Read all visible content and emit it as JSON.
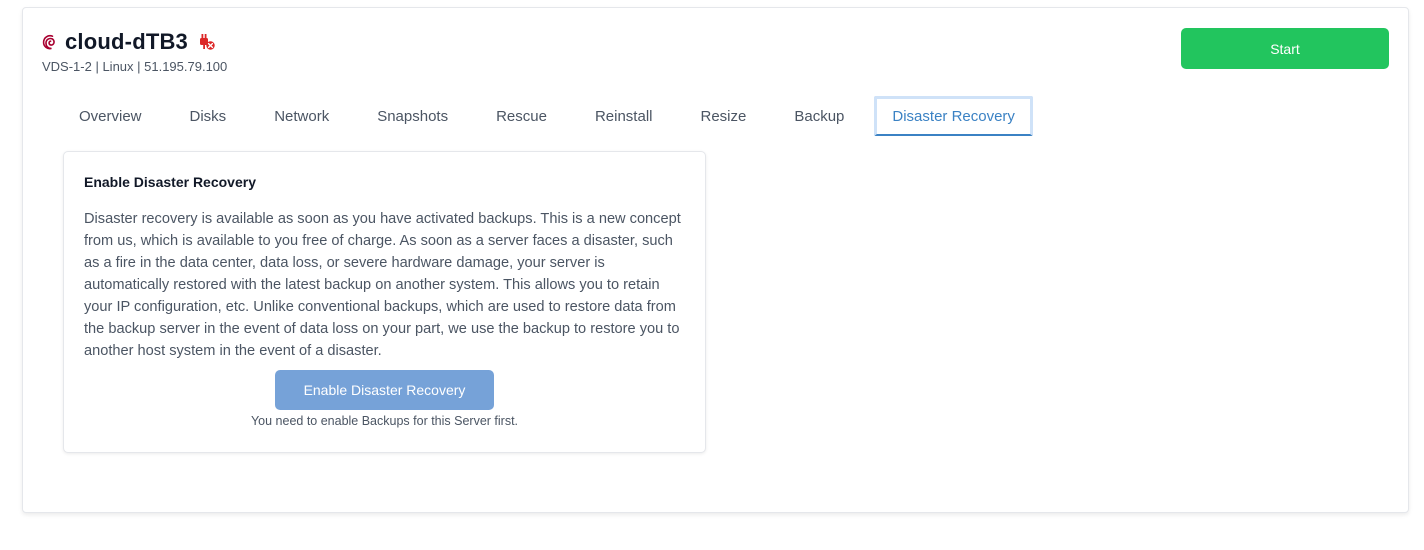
{
  "server": {
    "name": "cloud-dTB3",
    "subtitle": "VDS-1-2 | Linux | 51.195.79.100",
    "os_icon": "debian-icon",
    "status_icon": "plug-off-icon"
  },
  "actions": {
    "start_label": "Start"
  },
  "tabs": [
    {
      "label": "Overview"
    },
    {
      "label": "Disks"
    },
    {
      "label": "Network"
    },
    {
      "label": "Snapshots"
    },
    {
      "label": "Rescue"
    },
    {
      "label": "Reinstall"
    },
    {
      "label": "Resize"
    },
    {
      "label": "Backup"
    },
    {
      "label": "Disaster Recovery",
      "active": true
    }
  ],
  "disaster_recovery": {
    "title": "Enable Disaster Recovery",
    "description": "Disaster recovery is available as soon as you have activated backups. This is a new concept from us, which is available to you free of charge. As soon as a server faces a disaster, such as a fire in the data center, data loss, or severe hardware damage, your server is automatically restored with the latest backup on another system. This allows you to retain your IP configuration, etc. Unlike conventional backups, which are used to restore data from the backup server in the event of data loss on your part, we use the backup to restore you to another host system in the event of a disaster.",
    "button_label": "Enable Disaster Recovery",
    "hint": "You need to enable Backups for this Server first."
  },
  "colors": {
    "start_button": "#22c55e",
    "enable_button_disabled": "#76a2d8",
    "active_tab": "#3b82c4",
    "status_icon": "#dc2626",
    "debian": "#a80030"
  }
}
